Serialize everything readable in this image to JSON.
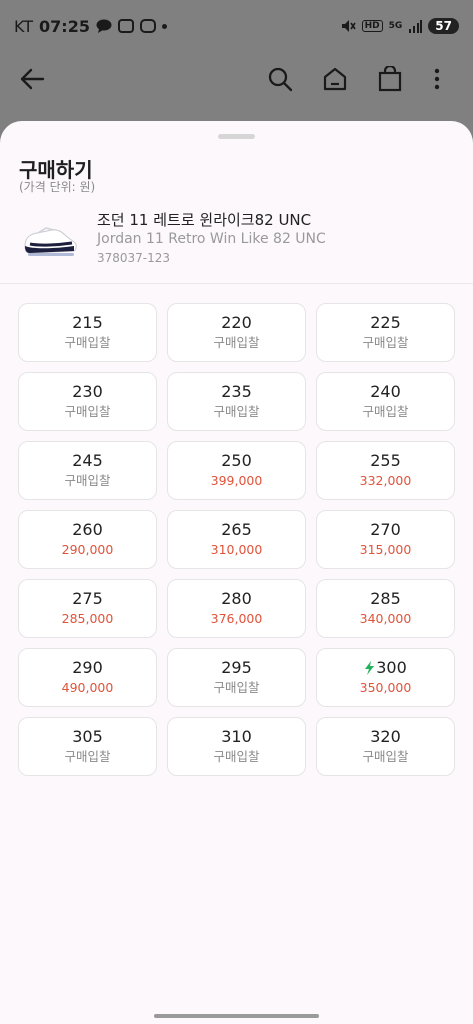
{
  "status_bar": {
    "carrier": "KT",
    "time": "07:25",
    "network_badge": "HD",
    "signal": "5G",
    "battery": "57"
  },
  "app_bar": {
    "icons": [
      "back-arrow-icon",
      "search-icon",
      "home-icon",
      "shopping-bag-icon",
      "more-vertical-icon"
    ]
  },
  "sheet": {
    "title": "구매하기",
    "price_unit": "(가격 단위: 원)",
    "product": {
      "name_ko": "조던 11 레트로 윈라이크82 UNC",
      "name_en": "Jordan 11 Retro Win Like 82 UNC",
      "code": "378037-123"
    },
    "sizes": [
      {
        "size": "215",
        "price": "구매입찰",
        "has_price": false,
        "fast": false
      },
      {
        "size": "220",
        "price": "구매입찰",
        "has_price": false,
        "fast": false
      },
      {
        "size": "225",
        "price": "구매입찰",
        "has_price": false,
        "fast": false
      },
      {
        "size": "230",
        "price": "구매입찰",
        "has_price": false,
        "fast": false
      },
      {
        "size": "235",
        "price": "구매입찰",
        "has_price": false,
        "fast": false
      },
      {
        "size": "240",
        "price": "구매입찰",
        "has_price": false,
        "fast": false
      },
      {
        "size": "245",
        "price": "구매입찰",
        "has_price": false,
        "fast": false
      },
      {
        "size": "250",
        "price": "399,000",
        "has_price": true,
        "fast": false
      },
      {
        "size": "255",
        "price": "332,000",
        "has_price": true,
        "fast": false
      },
      {
        "size": "260",
        "price": "290,000",
        "has_price": true,
        "fast": false
      },
      {
        "size": "265",
        "price": "310,000",
        "has_price": true,
        "fast": false
      },
      {
        "size": "270",
        "price": "315,000",
        "has_price": true,
        "fast": false
      },
      {
        "size": "275",
        "price": "285,000",
        "has_price": true,
        "fast": false
      },
      {
        "size": "280",
        "price": "376,000",
        "has_price": true,
        "fast": false
      },
      {
        "size": "285",
        "price": "340,000",
        "has_price": true,
        "fast": false
      },
      {
        "size": "290",
        "price": "490,000",
        "has_price": true,
        "fast": false
      },
      {
        "size": "295",
        "price": "구매입찰",
        "has_price": false,
        "fast": false
      },
      {
        "size": "300",
        "price": "350,000",
        "has_price": true,
        "fast": true
      },
      {
        "size": "305",
        "price": "구매입찰",
        "has_price": false,
        "fast": false
      },
      {
        "size": "310",
        "price": "구매입찰",
        "has_price": false,
        "fast": false
      },
      {
        "size": "320",
        "price": "구매입찰",
        "has_price": false,
        "fast": false
      }
    ]
  },
  "colors": {
    "price_red": "#e0533b",
    "fast_green": "#22b35a",
    "overlay": "#808080"
  }
}
